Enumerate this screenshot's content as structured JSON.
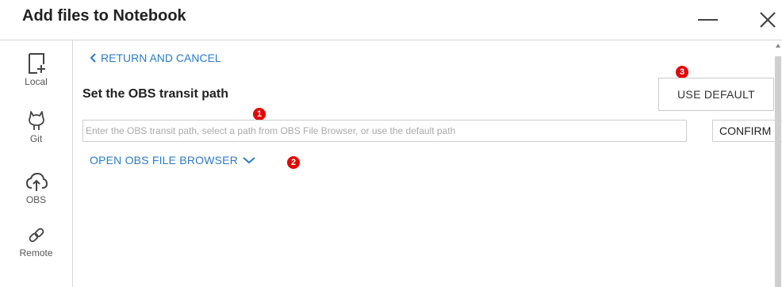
{
  "dialog": {
    "title": "Add files to Notebook"
  },
  "sidebar": {
    "items": [
      {
        "label": "Local",
        "icon": "local-file-add-icon"
      },
      {
        "label": "Git",
        "icon": "github-icon"
      },
      {
        "label": "OBS",
        "icon": "cloud-upload-icon"
      },
      {
        "label": "Remote",
        "icon": "link-icon"
      }
    ]
  },
  "main": {
    "return_label": "RETURN AND CANCEL",
    "section_title": "Set the OBS transit path",
    "use_default_label": "USE DEFAULT",
    "path_input": {
      "value": "",
      "placeholder": "Enter the OBS transit path, select a path from OBS File Browser, or use the default path"
    },
    "confirm_label": "CONFIRM",
    "open_browser_label": "OPEN OBS FILE BROWSER"
  },
  "badges": [
    "1",
    "2",
    "3"
  ],
  "colors": {
    "link": "#2d7bc7",
    "badge": "#e60000",
    "border": "#cfcfcf"
  }
}
